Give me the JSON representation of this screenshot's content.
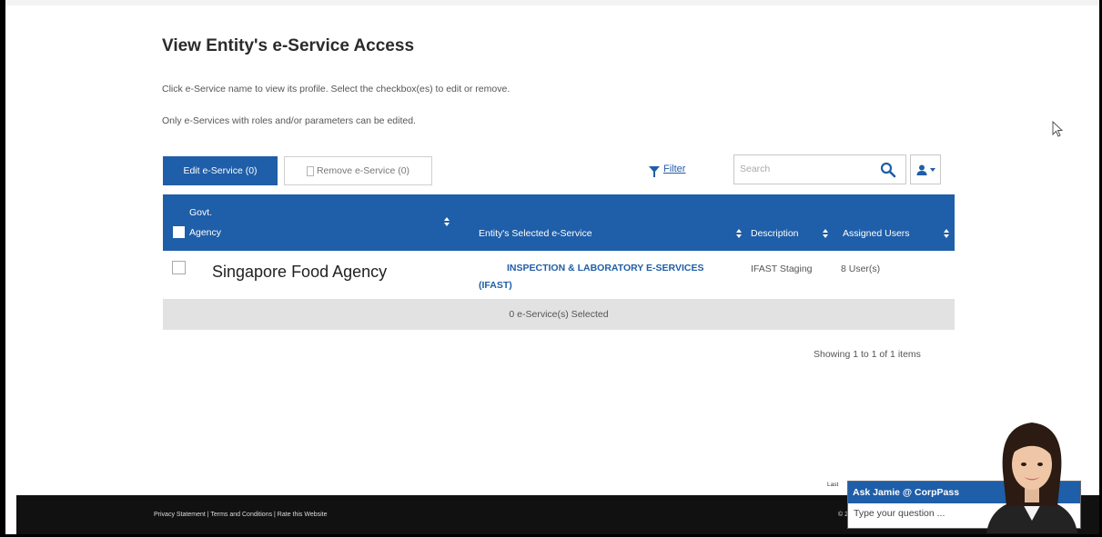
{
  "page": {
    "title": "View Entity's e-Service Access",
    "instruction_1": "Click e-Service name to view its profile. Select the checkbox(es) to edit or remove.",
    "instruction_2": "Only e-Services with roles and/or parameters can be edited."
  },
  "toolbar": {
    "edit_label": "Edit e-Service (0)",
    "remove_label": "Remove e-Service (0)",
    "filter_label": "Filter",
    "search_placeholder": "Search"
  },
  "table": {
    "columns": {
      "agency_line1": "Govt.",
      "agency_line2": "Agency",
      "eservice": "Entity's Selected e-Service",
      "description": "Description",
      "assigned_users": "Assigned Users"
    },
    "rows": [
      {
        "agency": "Singapore Food Agency",
        "eservice": "INSPECTION & LABORATORY E-SERVICES (IFAST)",
        "description": "IFAST Staging",
        "assigned_users": "8 User(s)"
      }
    ],
    "selected_summary": "0 e-Service(s) Selected",
    "showing": "Showing 1 to 1 of 1 items"
  },
  "footer": {
    "links": "Privacy Statement | Terms and Conditions | Rate this Website",
    "right_fragment": "© 2",
    "last_updated_fragment": "Last"
  },
  "chat": {
    "title": "Ask Jamie @ CorpPass",
    "placeholder": "Type your question ..."
  },
  "colors": {
    "primary": "#1f5ea8",
    "footer_bg": "#111111",
    "selected_bar": "#e2e2e2"
  },
  "icons": [
    "filter-icon",
    "search-icon",
    "user-icon",
    "trash-icon",
    "sort-icon",
    "mouse-cursor-icon"
  ]
}
